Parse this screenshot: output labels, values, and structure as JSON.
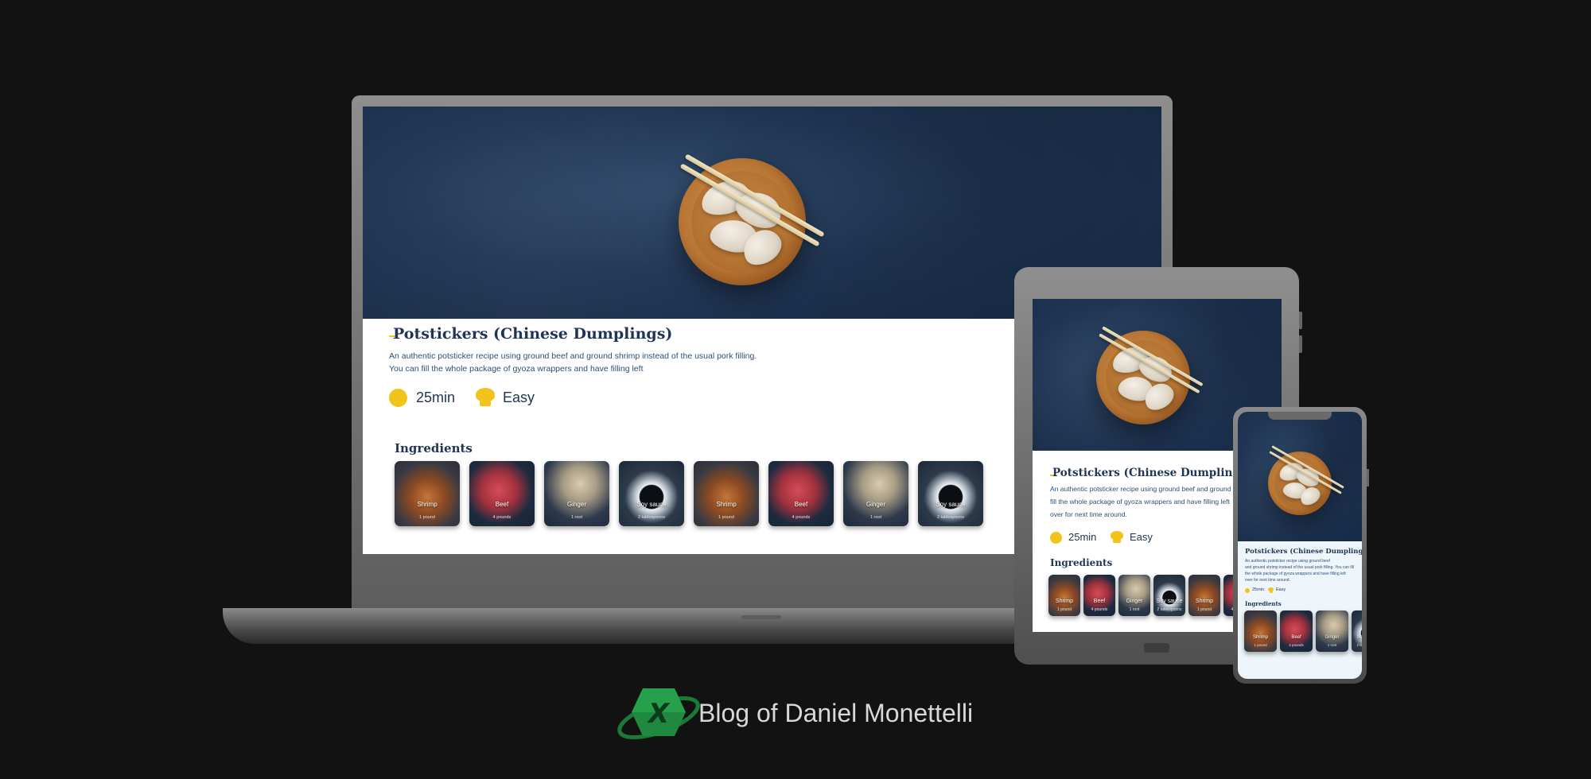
{
  "recipe": {
    "title": "Potstickers (Chinese Dumplings)",
    "description_line1": "An authentic potsticker recipe using ground beef and ground shrimp instead of the usual pork filling.",
    "description_line2": "You can fill the whole package of gyoza wrappers and have filling left",
    "tablet_desc_line1": "An authentic potsticker recipe using ground beef and ground s",
    "tablet_desc_line2": "fill the whole package of gyoza wrappers and have filling left",
    "tablet_desc_line3": "over for next time around.",
    "phone_desc_line1": "An authentic potsticker recipe using ground beef",
    "phone_desc_line2": "and ground shrimp instead of the usual pork filling. You can fill",
    "phone_desc_line3": "the whole package of gyoza wrappers and have filling left",
    "phone_desc_line4": "over for next time around.",
    "time": "25min",
    "difficulty": "Easy",
    "ingredients_heading": "Ingredients",
    "ingredients": [
      {
        "name": "Shrimp",
        "quantity": "1 pound",
        "image": "shrimp"
      },
      {
        "name": "Beef",
        "quantity": "4 pounds",
        "image": "beef"
      },
      {
        "name": "Ginger",
        "quantity": "1 root",
        "image": "ginger"
      },
      {
        "name": "Soy sauce",
        "quantity": "2 tablespoons",
        "image": "soy"
      },
      {
        "name": "Shrimp",
        "quantity": "1 pound",
        "image": "shrimp"
      },
      {
        "name": "Beef",
        "quantity": "4 pounds",
        "image": "beef"
      },
      {
        "name": "Ginger",
        "quantity": "1 root",
        "image": "ginger"
      },
      {
        "name": "Soy sauce",
        "quantity": "2 tablespoons",
        "image": "soy"
      }
    ]
  },
  "branding": {
    "blog_name": "Blog of Daniel Monettelli",
    "logo_letter": "X"
  },
  "colors": {
    "page_bg": "#121212",
    "title_navy": "#1e3557",
    "accent_yellow": "#f2c31a",
    "logo_green": "#1f8a3f"
  },
  "icons": {
    "time": "clock-circle-icon",
    "difficulty": "chef-hat-icon"
  }
}
